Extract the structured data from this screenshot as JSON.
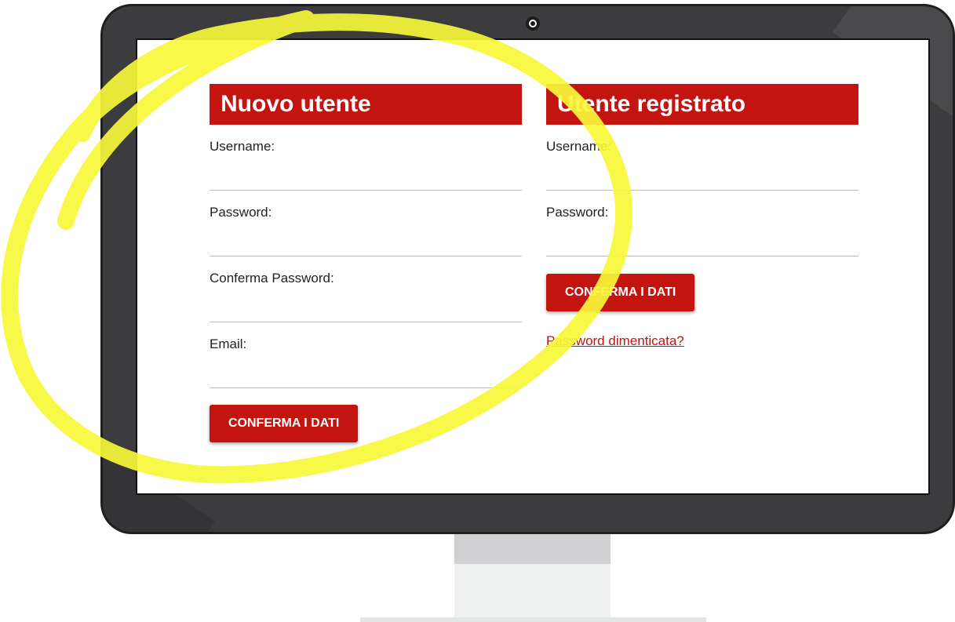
{
  "colors": {
    "accent": "#c41410",
    "bezel": "#3c3c3e",
    "highlight": "#f7f73a",
    "screen_bg": "#ffffff"
  },
  "new_user": {
    "title": "Nuovo utente",
    "fields": [
      {
        "label": "Username:",
        "value": ""
      },
      {
        "label": "Password:",
        "value": ""
      },
      {
        "label": "Conferma Password:",
        "value": ""
      },
      {
        "label": "Email:",
        "value": ""
      }
    ],
    "submit_label": "CONFERMA I DATI"
  },
  "registered_user": {
    "title": "Utente registrato",
    "fields": [
      {
        "label": "Username:",
        "value": ""
      },
      {
        "label": "Password:",
        "value": ""
      }
    ],
    "submit_label": "CONFERMA I DATI",
    "forgot_link": "Password dimenticata?"
  },
  "icons": {
    "camera": "webcam-icon"
  }
}
